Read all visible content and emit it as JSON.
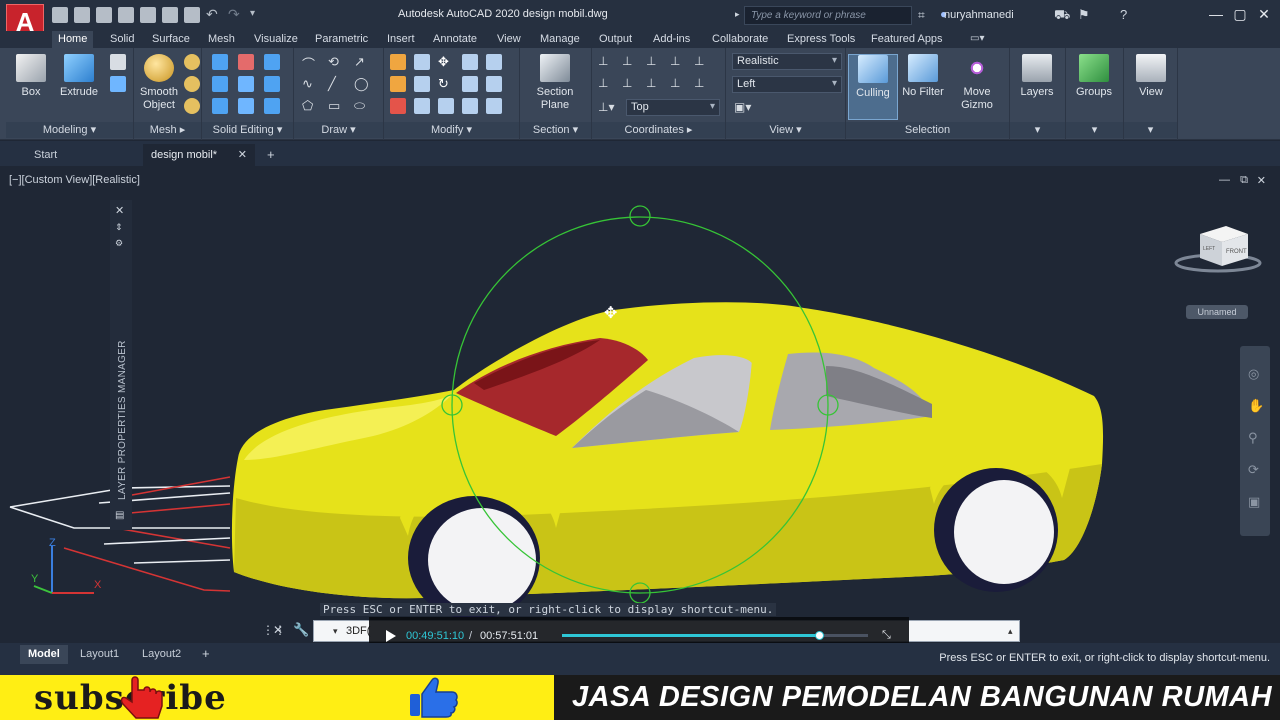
{
  "app": {
    "title": "Autodesk AutoCAD 2020   design mobil.dwg",
    "logo_letter": "A",
    "search_placeholder": "Type a keyword or phrase",
    "user": "nuryahmanedi"
  },
  "ribbon_tabs": [
    "Home",
    "Solid",
    "Surface",
    "Mesh",
    "Visualize",
    "Parametric",
    "Insert",
    "Annotate",
    "View",
    "Manage",
    "Output",
    "Add-ins",
    "Collaborate",
    "Express Tools",
    "Featured Apps"
  ],
  "active_tab": "Home",
  "ribbon": {
    "box_label": "Box",
    "extrude_label": "Extrude",
    "smooth_label_1": "Smooth",
    "smooth_label_2": "Object",
    "section_plane_1": "Section",
    "section_plane_2": "Plane",
    "culling_label": "Culling",
    "nofilter_label": "No Filter",
    "movegizmo_1": "Move",
    "movegizmo_2": "Gizmo",
    "layers_label": "Layers",
    "groups_label": "Groups",
    "view_label": "View",
    "visual_style": "Realistic",
    "view_dir": "Left",
    "ucs_view": "Top",
    "panels": {
      "modeling": "Modeling",
      "mesh": "Mesh",
      "solid_editing": "Solid Editing",
      "draw": "Draw",
      "modify": "Modify",
      "section": "Section",
      "coordinates": "Coordinates",
      "view": "View",
      "selection": "Selection"
    }
  },
  "file_tabs": {
    "start": "Start",
    "drawing": "design mobil*"
  },
  "viewport": {
    "label": "[−][Custom View][Realistic]",
    "layer_palette": "LAYER PROPERTIES MANAGER",
    "viewcube_face": "FRONT",
    "viewcube_side": "LEFT",
    "ucs_name": "Unnamed",
    "axis_x": "X",
    "axis_y": "Y",
    "axis_z": "Z"
  },
  "command": {
    "prompt": "Press ESC or ENTER to exit, or right-click to display shortcut-menu.",
    "current": "3DF("
  },
  "player": {
    "current_time": "00:49:51:10",
    "separator": "/",
    "total_time": "00:57:51:01",
    "progress": 0.84
  },
  "layout_tabs": [
    "Model",
    "Layout1",
    "Layout2"
  ],
  "status_message": "Press ESC or ENTER to exit, or right-click to display shortcut-menu.",
  "banner": {
    "subscribe": "subscribe",
    "text": "JASA DESIGN  PEMODELAN BANGUNAN RUMAH"
  },
  "colors": {
    "car_body": "#e9e51a",
    "windshield": "#a8272b",
    "orbit_circle": "#3cc23c",
    "banner_yellow": "#ffee14",
    "accent_cyan": "#2ec7d6"
  }
}
